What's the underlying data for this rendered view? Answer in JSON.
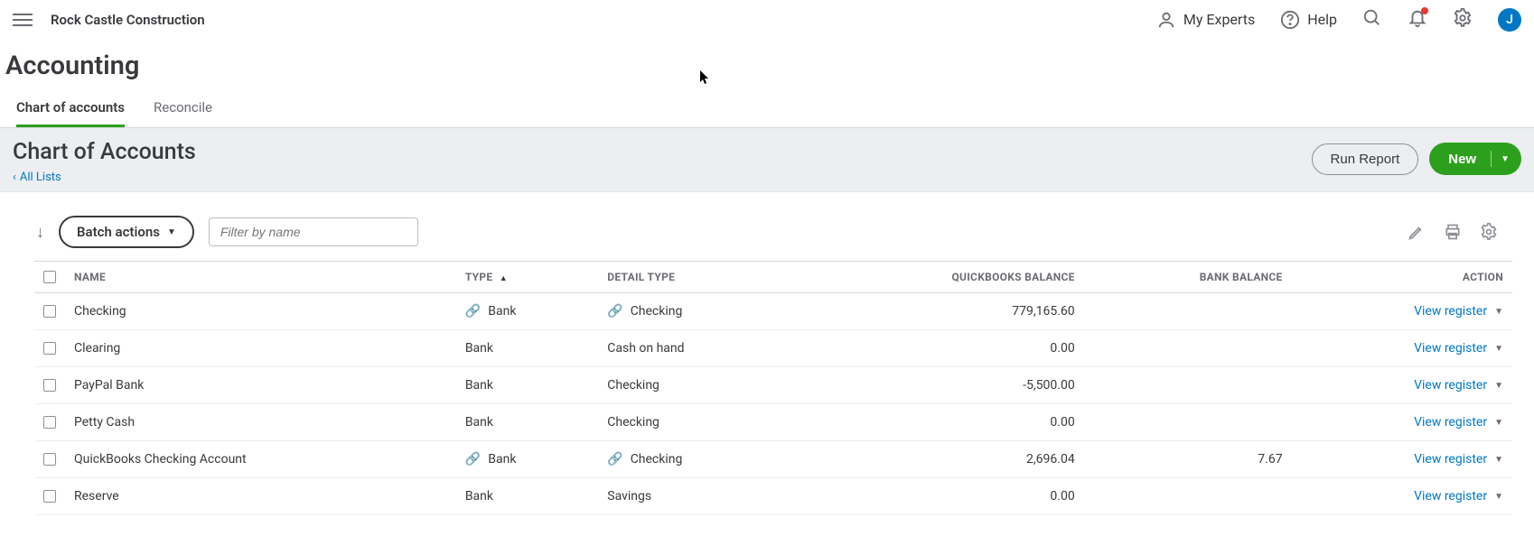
{
  "header": {
    "company": "Rock Castle Construction",
    "my_experts": "My Experts",
    "help": "Help",
    "avatar_initial": "J"
  },
  "page": {
    "title": "Accounting"
  },
  "tabs": {
    "chart": "Chart of accounts",
    "reconcile": "Reconcile"
  },
  "subheader": {
    "title": "Chart of Accounts",
    "back": "All Lists",
    "run_report": "Run Report",
    "new": "New"
  },
  "tools": {
    "batch": "Batch actions",
    "filter_placeholder": "Filter by name"
  },
  "columns": {
    "name": "NAME",
    "type": "TYPE",
    "detail": "DETAIL TYPE",
    "qb": "QUICKBOOKS BALANCE",
    "bank": "BANK BALANCE",
    "action": "ACTION"
  },
  "action_label": "View register",
  "rows": [
    {
      "name": "Checking",
      "type": "Bank",
      "type_linked": true,
      "detail": "Checking",
      "detail_linked": true,
      "qb": "779,165.60",
      "bank": ""
    },
    {
      "name": "Clearing",
      "type": "Bank",
      "type_linked": false,
      "detail": "Cash on hand",
      "detail_linked": false,
      "qb": "0.00",
      "bank": ""
    },
    {
      "name": "PayPal Bank",
      "type": "Bank",
      "type_linked": false,
      "detail": "Checking",
      "detail_linked": false,
      "qb": "-5,500.00",
      "bank": ""
    },
    {
      "name": "Petty Cash",
      "type": "Bank",
      "type_linked": false,
      "detail": "Checking",
      "detail_linked": false,
      "qb": "0.00",
      "bank": ""
    },
    {
      "name": "QuickBooks Checking Account",
      "type": "Bank",
      "type_linked": true,
      "detail": "Checking",
      "detail_linked": true,
      "qb": "2,696.04",
      "bank": "7.67"
    },
    {
      "name": "Reserve",
      "type": "Bank",
      "type_linked": false,
      "detail": "Savings",
      "detail_linked": false,
      "qb": "0.00",
      "bank": ""
    }
  ]
}
